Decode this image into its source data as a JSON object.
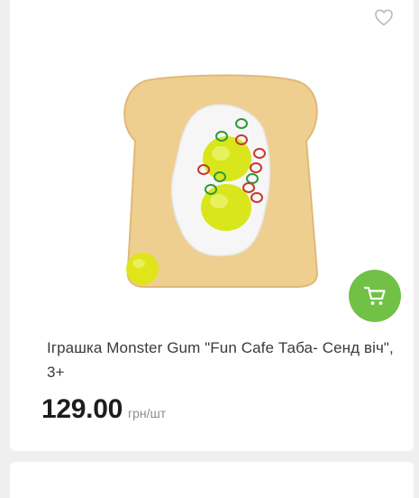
{
  "product": {
    "title": "Іграшка Monster Gum \"Fun Cafe Таба- Сенд віч\", 3+",
    "price": "129.00",
    "unit": "грн/шт",
    "image_icon": "toast-with-egg-toy-image"
  },
  "actions": {
    "favorite_icon": "heart-outline-icon",
    "cart_icon": "shopping-cart-icon"
  },
  "colors": {
    "accent": "#71c146",
    "background": "#efefef",
    "card": "#ffffff",
    "price_text": "#1d1d1d",
    "unit_text": "#8a8a8a"
  }
}
